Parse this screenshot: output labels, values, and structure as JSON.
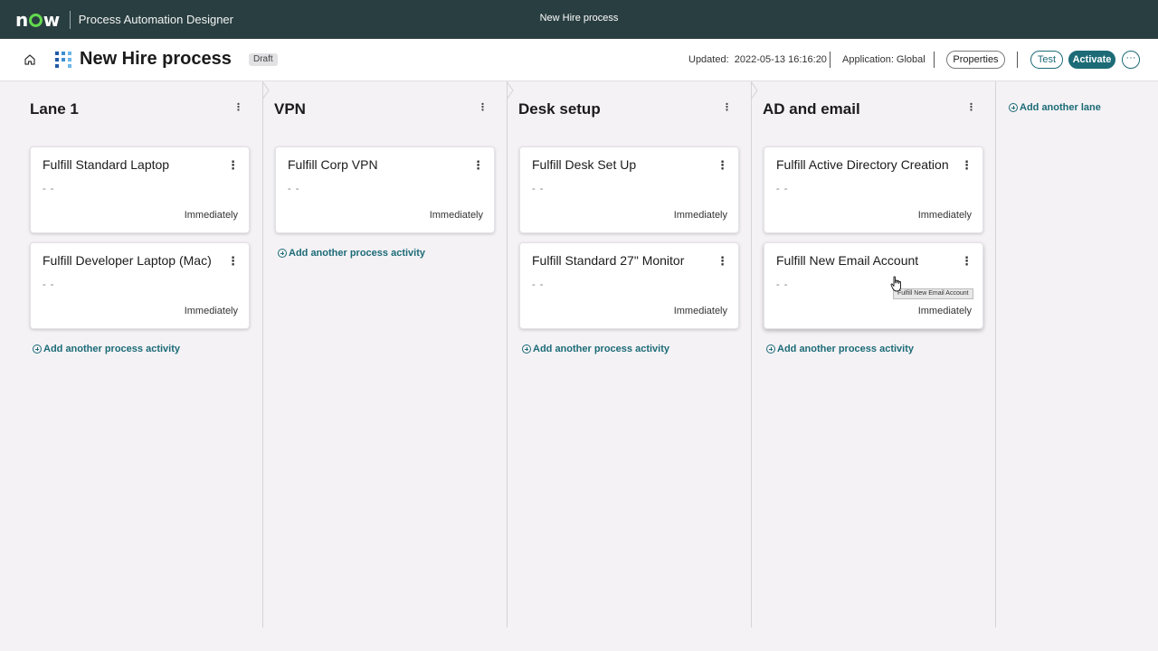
{
  "topbar": {
    "logo": "now",
    "app_name": "Process Automation Designer",
    "center_title": "New Hire process"
  },
  "header": {
    "title": "New Hire process",
    "status": "Draft",
    "updated_label": "Updated:",
    "updated_value": "2022-05-13 16:16:20",
    "application": "Application: Global",
    "properties_label": "Properties",
    "test_label": "Test",
    "activate_label": "Activate",
    "more_label": "···"
  },
  "lanes": [
    {
      "title": "Lane 1",
      "cards": [
        {
          "title": "Fulfill Standard Laptop",
          "sub": "- -",
          "time": "Immediately"
        },
        {
          "title": "Fulfill Developer Laptop (Mac)",
          "sub": "- -",
          "time": "Immediately"
        }
      ],
      "add_label": "Add another process activity"
    },
    {
      "title": "VPN",
      "cards": [
        {
          "title": "Fulfill Corp VPN",
          "sub": "- -",
          "time": "Immediately"
        }
      ],
      "add_label": "Add another process activity"
    },
    {
      "title": "Desk setup",
      "cards": [
        {
          "title": "Fulfill Desk Set Up",
          "sub": "- -",
          "time": "Immediately"
        },
        {
          "title": "Fulfill Standard 27\" Monitor",
          "sub": "- -",
          "time": "Immediately"
        }
      ],
      "add_label": "Add another process activity"
    },
    {
      "title": "AD and email",
      "cards": [
        {
          "title": "Fulfill Active Directory Creation",
          "sub": "- -",
          "time": "Immediately"
        },
        {
          "title": "Fulfill New Email Account",
          "sub": "- -",
          "time": "Immediately"
        }
      ],
      "add_label": "Add another process activity"
    }
  ],
  "add_lane_label": "Add another lane",
  "tooltip": "Fulfill New Email Account",
  "colors": {
    "topbar": "#293e40",
    "accent": "#1c6b77",
    "logo_green": "#62d84e",
    "board_bg": "#f4f2f5"
  }
}
